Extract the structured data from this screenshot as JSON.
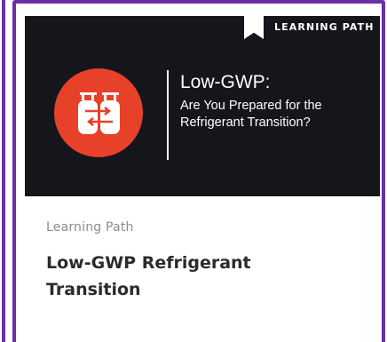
{
  "card": {
    "hero_tag": "LEARNING PATH",
    "hero_title": "Low-GWP:",
    "hero_subtitle": "Are You Prepared for the Refrigerant Transition?",
    "category": "Learning Path",
    "title": "Low-GWP Refrigerant Transition"
  },
  "icons": {
    "bookmark": "bookmark-ribbon-icon",
    "logo": "refrigerant-cylinders-icon"
  },
  "colors": {
    "border": "#6b2fa8",
    "hero_background": "#15161b",
    "logo_circle": "#e8412a",
    "title_text": "#2b2b2b",
    "category_text": "#8b8b8b"
  }
}
